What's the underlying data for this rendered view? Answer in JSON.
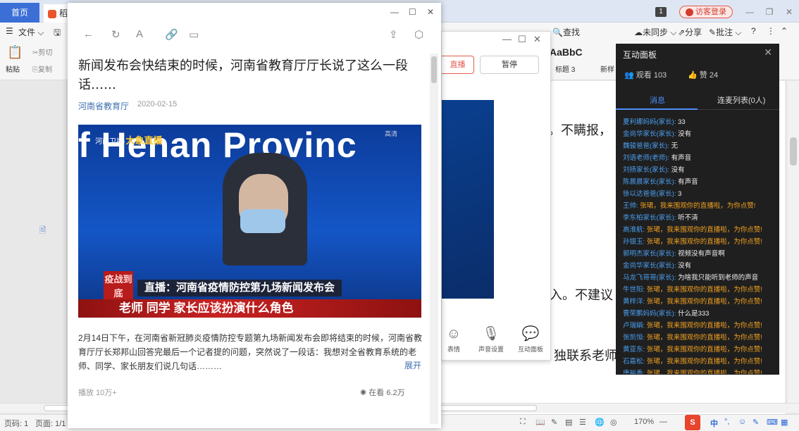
{
  "wps": {
    "tab_home": "首页",
    "tab_doc": "稻",
    "badge": "1",
    "login_label": "访客登录",
    "menu_file": "文件",
    "find": "查找",
    "unsync": "未同步",
    "share": "分享",
    "annotate": "批注",
    "help": "?",
    "cut": "剪切",
    "copy": "复制",
    "paste": "粘贴",
    "style_sample": "AaBbC",
    "style_name": "标题 3",
    "new_style": "新样",
    "doc_line1": "。不瞒报，",
    "doc_line2": "入。不建议",
    "doc_line3": "独联系老师",
    "status_page": "页码: 1",
    "status_pages": "页面: 1/1",
    "zoom": "170%",
    "ime": "中",
    "ime_punct": "°,"
  },
  "player": {
    "live_btn": "直播",
    "pause_btn": "暂停",
    "bottom": [
      {
        "icon": "smile-icon",
        "label": "表情"
      },
      {
        "icon": "mic-icon",
        "label": "声音设置"
      },
      {
        "icon": "chat-icon",
        "label": "互动面板"
      }
    ]
  },
  "panel": {
    "title": "互动面板",
    "viewers": "观看 103",
    "likes": "赞 24",
    "tab_messages": "消息",
    "tab_mic": "连麦列表(0人)",
    "messages": [
      {
        "name": "夏利娜妈妈(家长):",
        "text": " 33",
        "gift": false
      },
      {
        "name": "金尚华家长(家长):",
        "text": " 没有",
        "gift": false
      },
      {
        "name": "魏骏爸爸(家长):",
        "text": " 无",
        "gift": false
      },
      {
        "name": "刘语老师(老师):",
        "text": " 有声音",
        "gift": false
      },
      {
        "name": "刘扬家长(家长):",
        "text": " 没有",
        "gift": false
      },
      {
        "name": "陈晨晨家长(家长):",
        "text": " 有声音",
        "gift": false
      },
      {
        "name": "徐以达爸爸(家长):",
        "text": " 3",
        "gift": false
      },
      {
        "name": "王帅:",
        "text": " 张珺，我来围观你的直播啦，为你点赞!",
        "gift": true
      },
      {
        "name": "李东柏家长(家长):",
        "text": " 听不清",
        "gift": false
      },
      {
        "name": "高淮航:",
        "text": " 张珺，我来围观你的直播啦，为你点赞!",
        "gift": true
      },
      {
        "name": "孙银玉:",
        "text": " 张珺，我来围观你的直播啦，为你点赞!",
        "gift": true
      },
      {
        "name": "郭明杰家长(家长):",
        "text": " 视频没有声音啊",
        "gift": false
      },
      {
        "name": "金尚华家长(家长):",
        "text": " 没有",
        "gift": false
      },
      {
        "name": "马龙飞哥哥(家长):",
        "text": " 为啥我只能听到老师的声音",
        "gift": false
      },
      {
        "name": "牛世阳:",
        "text": " 张珺，我来围观你的直播啦，为你点赞!",
        "gift": true
      },
      {
        "name": "黄梓洋:",
        "text": " 张珺，我来围观你的直播啦，为你点赞!",
        "gift": true
      },
      {
        "name": "曹荣鹏妈妈(家长):",
        "text": " 什么是333",
        "gift": false
      },
      {
        "name": "卢瑞娟:",
        "text": " 张珺，我来围观你的直播啦，为你点赞!",
        "gift": true
      },
      {
        "name": "张凯恒:",
        "text": " 张珺，我来围观你的直播啦，为你点赞!",
        "gift": true
      },
      {
        "name": "黄亚东:",
        "text": " 张珺，我来围观你的直播啦，为你点赞!",
        "gift": true
      },
      {
        "name": "石嘉松:",
        "text": " 张珺，我来围观你的直播啦，为你点赞!",
        "gift": true
      },
      {
        "name": "唐裕香:",
        "text": " 张珺，我来围观你的直播啦，为你点赞!",
        "gift": true
      }
    ]
  },
  "article": {
    "title": "新闻发布会快结束的时候，河南省教育厅厅长说了这么一段话……",
    "source": "河南省教育厅",
    "date": "2020-02-15",
    "image": {
      "bg_text": "f Henan Provinc",
      "logo": "河南卫视·",
      "logo_brand": "大象直播",
      "hd": "高清",
      "tag": "疫战到底",
      "caption1": "直播：河南省疫情防控第九场新闻发布会",
      "caption2": "老师 同学 家长应该扮演什么角色"
    },
    "body": "2月14日下午，在河南省新冠肺炎疫情防控专题第九场新闻发布会即将结束的时候，河南省教育厅厅长郑邦山回答完最后一个记者提的问题，突然说了一段话：我想对全省教育系统的老师、同学、家长朋友们说几句话………",
    "expand": "展开",
    "plays": "播放 10万+",
    "watching": "在看 6.2万"
  }
}
